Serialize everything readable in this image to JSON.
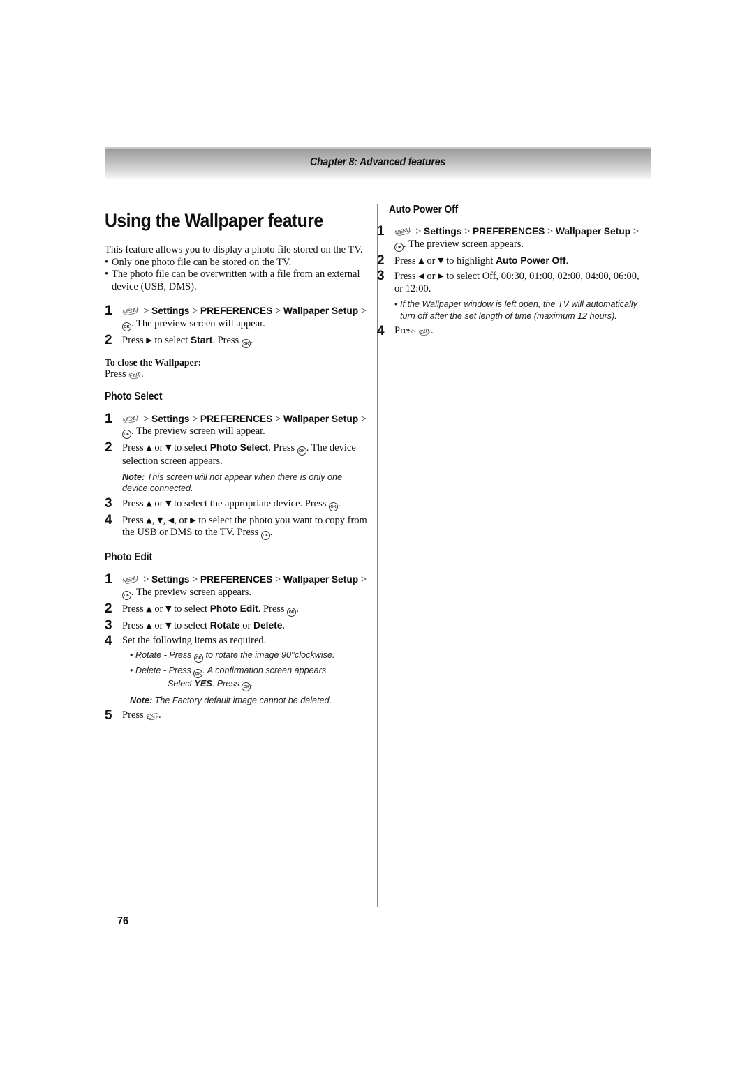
{
  "header": {
    "chapter_title": "Chapter 8: Advanced features"
  },
  "page_title": "Using the Wallpaper feature",
  "intro": {
    "text": "This feature allows you to display a photo file stored on the TV.",
    "bullets": [
      "Only one photo file can be stored on the TV.",
      "The photo file can be overwritten with a file from an external device (USB, DMS)."
    ]
  },
  "icons": {
    "menu": "MENU",
    "ok": "OK",
    "exit": "EXIT",
    "bullet": "•",
    "arrow_up": "▲",
    "arrow_down": "▼",
    "arrow_left": "◀",
    "arrow_right": "▶"
  },
  "common": {
    "sep": ">",
    "settings": "Settings",
    "preferences": "PREFERENCES",
    "wallpaper": "Wallpaper",
    "setup": "Setup",
    "press": "Press",
    "or": "or"
  },
  "main_steps": {
    "step1_num": "1",
    "step1_tail": ". The preview screen will appear.",
    "step2_num": "2",
    "step2_pre": "Press",
    "step2_mid": "to select",
    "step2_bold": "Start",
    "step2_post": ". Press",
    "close_label": "To close the Wallpaper:",
    "close_text": "Press"
  },
  "photo_select": {
    "heading": "Photo Select",
    "step1_num": "1",
    "step1_tail": ". The preview screen will appear.",
    "step2_num": "2",
    "step2_mid": "to select",
    "step2_bold": "Photo Select",
    "step2_post": ". Press",
    "step2_tail": ". The device selection screen appears.",
    "note_label": "Note:",
    "note_text": " This screen will not appear when there is only one device connected.",
    "step3_num": "3",
    "step3_text": "to select the appropriate device. Press",
    "step4_num": "4",
    "step4_text": "to select the photo you want to copy from the USB or DMS to the TV. Press"
  },
  "photo_edit": {
    "heading": "Photo Edit",
    "step1_num": "1",
    "step1_tail": ". The preview screen appears.",
    "step2_num": "2",
    "step2_mid": "to select",
    "step2_bold": "Photo Edit",
    "step2_post": ". Press",
    "step3_num": "3",
    "step3_mid": "to select",
    "step3_bold1": "Rotate",
    "step3_bold2": "Delete",
    "step4_num": "4",
    "step4_text": "Set the following items as required.",
    "sub_rotate_pre": "Rotate - Press",
    "sub_rotate_post": "to rotate the image 90°clockwise.",
    "sub_delete_pre": "Delete - Press",
    "sub_delete_post": ". A confirmation screen appears.",
    "sub_delete_line2_pre": "Select",
    "sub_delete_line2_bold": "YES",
    "sub_delete_line2_post": ". Press",
    "note_label": "Note:",
    "note_text": " The Factory default image cannot be deleted.",
    "step5_num": "5"
  },
  "auto_power_off": {
    "heading": "Auto Power Off",
    "step1_num": "1",
    "step1_tail": ". The preview screen appears.",
    "step2_num": "2",
    "step2_mid": "to highlight",
    "step2_bold": "Auto Power Off",
    "step3_num": "3",
    "step3_text": "to select Off, 00:30, 01:00, 02:00, 04:00, 06:00, or 12:00.",
    "sub_note": "If the Wallpaper window is left open, the TV will automatically turn off after the set length of time (maximum 12 hours).",
    "step4_num": "4"
  },
  "footer": {
    "page_number": "76"
  }
}
